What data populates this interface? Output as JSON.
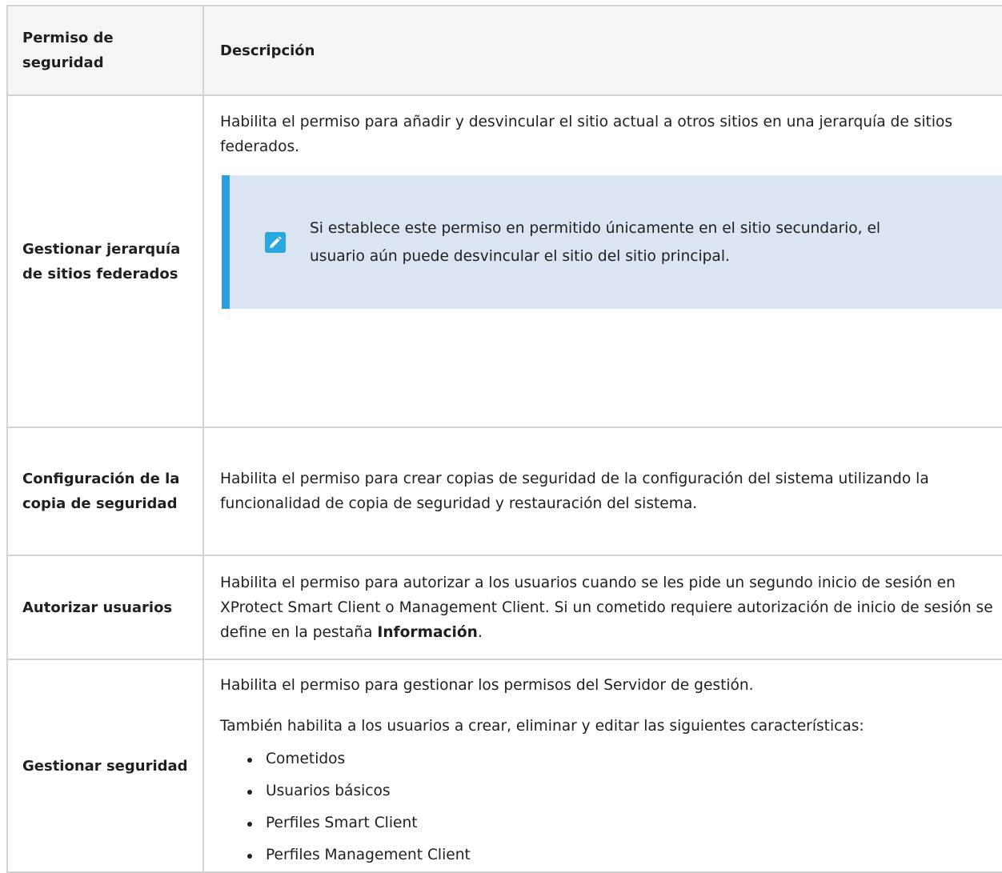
{
  "table": {
    "header": {
      "permission": "Permiso de seguridad",
      "description": "Descripción"
    },
    "rows": [
      {
        "permission": "Gestionar jerarquía de sitios federados",
        "description": "Habilita el permiso para añadir y desvincular el sitio actual a otros sitios en una jerarquía de sitios federados.",
        "note": {
          "icon": "pencil-note-icon",
          "text": "Si establece este permiso en permitido únicamente en el sitio secundario, el usuario aún puede desvincular el sitio del sitio principal."
        }
      },
      {
        "permission": "Configuración de la copia de seguridad",
        "description": "Habilita el permiso para crear copias de seguridad de la configuración del sistema utilizando la funcionalidad de copia de seguridad y restauración del sistema."
      },
      {
        "permission": "Autorizar usuarios",
        "description_before": "Habilita el permiso para autorizar a los usuarios cuando se les pide un segundo inicio de sesión en XProtect Smart Client o Management Client. Si un cometido requiere autorización de inicio de sesión se define en la pestaña ",
        "description_bold": "Información",
        "description_after": "."
      },
      {
        "permission": "Gestionar seguridad",
        "description": "Habilita el permiso para gestionar los permisos del Servidor de gestión.",
        "description_2": "También habilita a los usuarios a crear, eliminar y editar las siguientes características:",
        "items": [
          "Cometidos",
          "Usuarios básicos",
          "Perfiles Smart Client",
          "Perfiles Management Client"
        ]
      }
    ]
  },
  "colors": {
    "note_background": "#dbe4f2",
    "note_accent": "#2a9fdb",
    "header_background": "#f5f5f5",
    "border": "#d2d2d2"
  }
}
